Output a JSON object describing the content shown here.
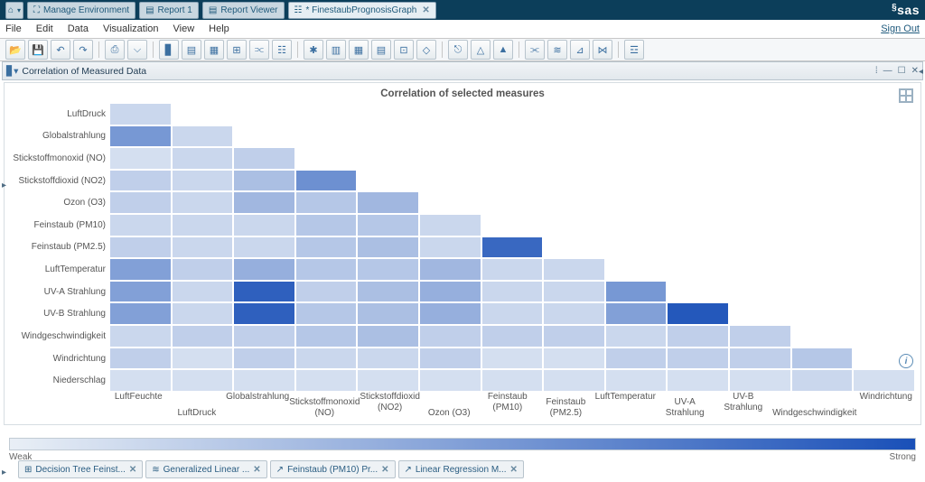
{
  "header": {
    "tabs": [
      {
        "icon": "⌂",
        "label": ""
      },
      {
        "icon": "⛶",
        "label": "Manage Environment"
      },
      {
        "icon": "▤",
        "label": "Report 1"
      },
      {
        "icon": "▤",
        "label": "Report Viewer"
      },
      {
        "icon": "☷",
        "label": "* FinestaubPrognosisGraph",
        "active": true,
        "closable": true
      }
    ],
    "logo": "sas"
  },
  "menu": [
    "File",
    "Edit",
    "Data",
    "Visualization",
    "View",
    "Help"
  ],
  "signout": "Sign Out",
  "panel": {
    "title": "Correlation of Measured Data",
    "chart_title": "Correlation of selected measures",
    "legend_weak": "Weak",
    "legend_strong": "Strong"
  },
  "chart_data": {
    "type": "heatmap",
    "title": "Correlation of selected measures",
    "y": [
      "LuftDruck",
      "Globalstrahlung",
      "Stickstoffmonoxid (NO)",
      "Stickstoffdioxid (NO2)",
      "Ozon (O3)",
      "Feinstaub (PM10)",
      "Feinstaub (PM2.5)",
      "LuftTemperatur",
      "UV-A Strahlung",
      "UV-B Strahlung",
      "Windgeschwindigkeit",
      "Windrichtung",
      "Niederschlag"
    ],
    "x": [
      "LuftFeuchte",
      "LuftDruck",
      "Globalstrahlung",
      "Stickstoffmonoxid (NO)",
      "Stickstoffdioxid (NO2)",
      "Ozon (O3)",
      "Feinstaub (PM10)",
      "Feinstaub (PM2.5)",
      "LuftTemperatur",
      "UV-A Strahlung",
      "UV-B Strahlung",
      "Windgeschwindigkeit",
      "Windrichtung"
    ],
    "legend": {
      "min": "Weak",
      "max": "Strong"
    },
    "note": "lower-triangle correlation matrix; values are visually estimated strength 0–1",
    "matrix": [
      [
        0.15
      ],
      [
        0.55,
        0.15
      ],
      [
        0.1,
        0.15,
        0.2
      ],
      [
        0.2,
        0.15,
        0.3,
        0.6
      ],
      [
        0.2,
        0.15,
        0.35,
        0.25,
        0.35
      ],
      [
        0.15,
        0.15,
        0.15,
        0.25,
        0.25,
        0.15
      ],
      [
        0.2,
        0.15,
        0.15,
        0.25,
        0.3,
        0.15,
        0.85
      ],
      [
        0.5,
        0.2,
        0.4,
        0.25,
        0.25,
        0.35,
        0.15,
        0.15
      ],
      [
        0.5,
        0.15,
        0.9,
        0.2,
        0.3,
        0.4,
        0.15,
        0.15,
        0.55
      ],
      [
        0.5,
        0.15,
        0.9,
        0.25,
        0.3,
        0.4,
        0.15,
        0.15,
        0.5,
        0.95
      ],
      [
        0.15,
        0.2,
        0.2,
        0.25,
        0.3,
        0.2,
        0.2,
        0.2,
        0.15,
        0.2,
        0.2
      ],
      [
        0.2,
        0.1,
        0.2,
        0.15,
        0.15,
        0.2,
        0.1,
        0.1,
        0.2,
        0.2,
        0.2,
        0.25
      ],
      [
        0.1,
        0.1,
        0.1,
        0.1,
        0.1,
        0.1,
        0.1,
        0.1,
        0.1,
        0.1,
        0.1,
        0.15,
        0.1
      ]
    ]
  },
  "bottom_tabs": [
    {
      "icon": "⊞",
      "label": "Decision Tree Feinst..."
    },
    {
      "icon": "≋",
      "label": "Generalized Linear ..."
    },
    {
      "icon": "↗",
      "label": "Feinstaub (PM10) Pr..."
    },
    {
      "icon": "↗",
      "label": "Linear Regression M..."
    }
  ],
  "tool_icons": [
    "📂",
    "💾",
    "↶",
    "↷",
    "|",
    "⎙",
    "⌵",
    "|",
    "▊",
    "▤",
    "▦",
    "⊞",
    "⫗",
    "☷",
    "|",
    "✱",
    "▥",
    "▦",
    "▤",
    "⊡",
    "◇",
    "|",
    "⎋",
    "△",
    "▲",
    "|",
    "⫘",
    "≋",
    "⊿",
    "⋈",
    "|",
    "☲"
  ]
}
